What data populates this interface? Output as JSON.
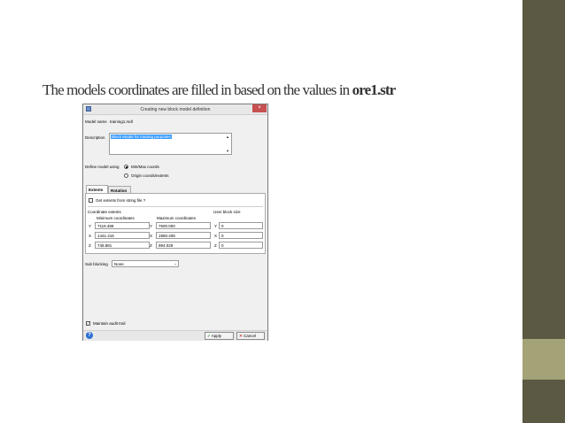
{
  "slide": {
    "title_prefix": "The models coordinates are filled in based on the values in ",
    "title_file": "ore1.str"
  },
  "dialog": {
    "title": "Creating new block model definition",
    "close_label": "×",
    "model_name_label": "Model name",
    "model_name_value": "training1.mdl",
    "description_label": "Description",
    "description_value": "Block Model for training purposes",
    "scroll_up": "▲",
    "scroll_down": "▼",
    "define_label": "Define model using",
    "radio_minmax": "Min/Max coords",
    "radio_origin": "Origin coords/extents",
    "tabs": {
      "extents": "Extents",
      "rotation": "Rotation"
    },
    "get_extents_label": "Get extents from string file ?",
    "coord_extents_label": "Coordinate extents",
    "user_block_size_label": "User block size",
    "min_label": "Minimum coordinates",
    "max_label": "Maximum coordinates",
    "rows": [
      {
        "axis": "Y",
        "min": "7119.489",
        "max_axis": "Y",
        "max": "7600.000",
        "user_axis": "Y",
        "user": "0"
      },
      {
        "axis": "X",
        "min": "1441.416",
        "max_axis": "X",
        "max": "1960.408",
        "user_axis": "X",
        "user": "0"
      },
      {
        "axis": "Z",
        "min": "748.881",
        "max_axis": "Z",
        "max": "994.029",
        "user_axis": "Z",
        "user": "0"
      }
    ],
    "sub_blocking_label": "Sub blocking",
    "sub_blocking_value": "None",
    "combo_arrow": "⌄",
    "audit_label": "Maintain audit trail",
    "audit_check": "✓",
    "help_label": "?",
    "apply_icon": "✓",
    "apply_label": "Apply",
    "cancel_icon": "✕",
    "cancel_label": "Cancel"
  },
  "colors": {
    "sidebar": "#5b5843",
    "sidebar_accent": "#a4a377",
    "selection": "#3399ff",
    "close_button": "#c75050"
  }
}
